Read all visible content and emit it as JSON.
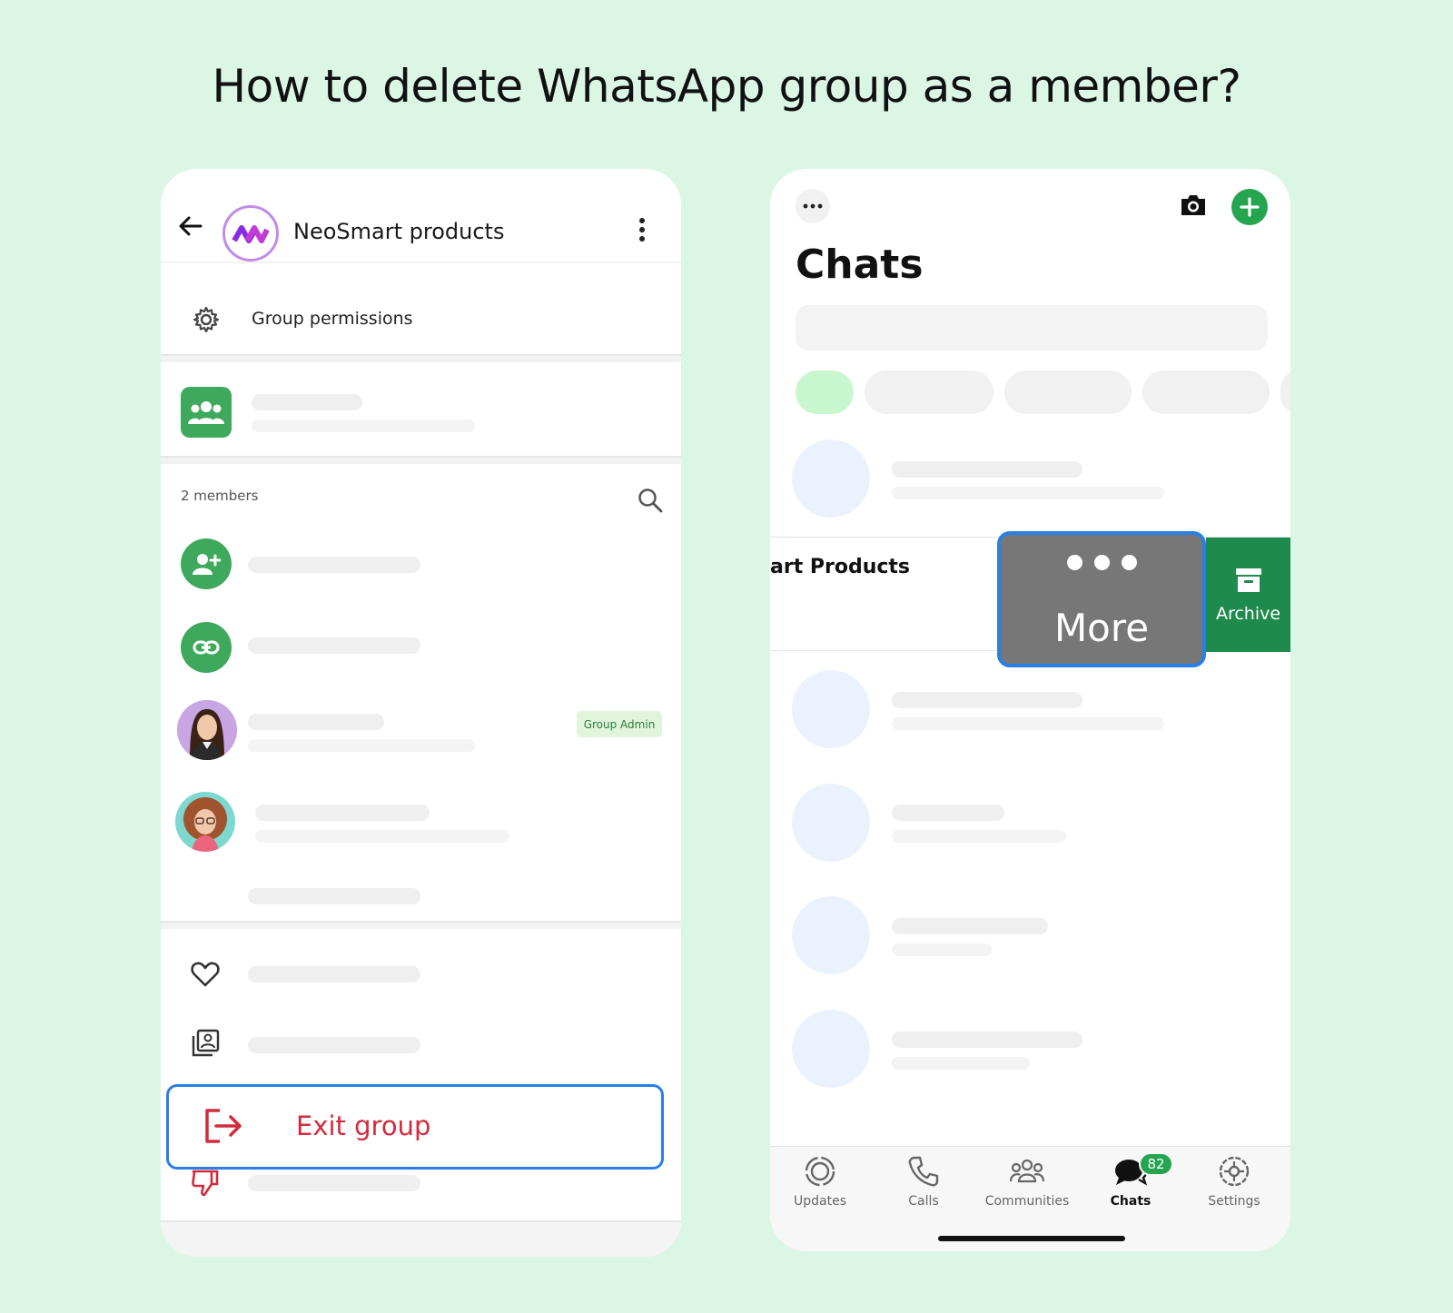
{
  "headline": "How to delete WhatsApp group as a member?",
  "left_screen": {
    "group_name": "NeoSmart products",
    "permissions_label": "Group permissions",
    "members_count": "2 members",
    "admin_badge": "Group Admin",
    "exit_label": "Exit group"
  },
  "right_screen": {
    "title": "Chats",
    "swiped_chat_title": "art Products",
    "more_label": "More",
    "archive_label": "Archive",
    "tabs": [
      {
        "label": "Updates",
        "icon": "updates-icon"
      },
      {
        "label": "Calls",
        "icon": "phone-icon"
      },
      {
        "label": "Communities",
        "icon": "communities-icon"
      },
      {
        "label": "Chats",
        "icon": "chat-bubble-icon",
        "active": true,
        "badge": "82"
      },
      {
        "label": "Settings",
        "icon": "gear-icon"
      }
    ]
  },
  "colors": {
    "background": "#dcf6e5",
    "whatsapp_green": "#25a550",
    "highlight_blue": "#2a7fe6",
    "exit_red": "#d12c3e"
  }
}
